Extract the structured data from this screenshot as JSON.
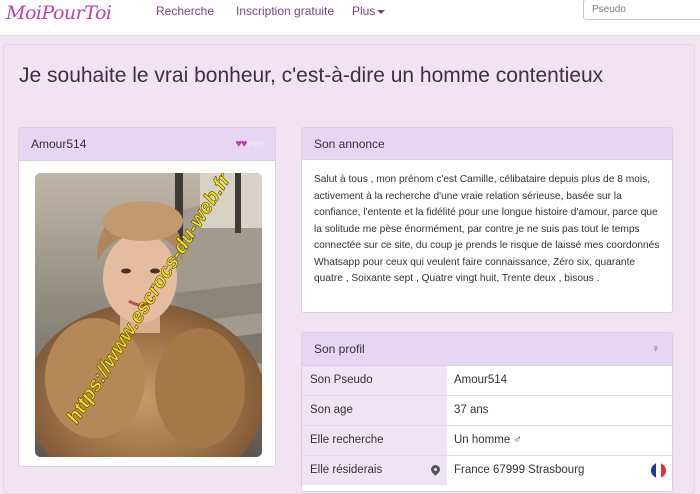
{
  "brand": {
    "logo_text": "MoiPourToi"
  },
  "nav": {
    "recherche": "Recherche",
    "inscription": "Inscription gratuite",
    "plus": "Plus"
  },
  "search": {
    "placeholder": "Pseudo"
  },
  "page": {
    "title": "Je souhaite le vrai bonheur, c'est-à-dire un homme contentieux"
  },
  "profile_card": {
    "username": "Amour514",
    "hearts_filled": 2,
    "hearts_total": 5,
    "photo_watermark": "https://www.escrocs-du-web.fr"
  },
  "annonce": {
    "heading": "Son annonce",
    "text": "Salut à tous , mon prénom c'est Camille, célibataire depuis plus de 8 mois, activement à la recherche d'une vraie relation sérieuse, basée sur la confiance, l'entente et la fidélité pour une longue histoire d'amour, parce que la solitude me pèse énormément, par contre je ne suis pas tout le temps connectée sur ce site, du coup je prends le risque de laissé mes coordonnés Whatsapp pour ceux qui veulent faire connaissance, Zéro six, quarante quatre , Soixante sept , Quatre vingt huit, Trente deux , bisous ."
  },
  "profil": {
    "heading": "Son profil",
    "rows": [
      {
        "label": "Son Pseudo",
        "value": "Amour514"
      },
      {
        "label": "Son age",
        "value": "37 ans"
      },
      {
        "label": "Elle recherche",
        "value": "Un homme ♂"
      },
      {
        "label": "Elle résiderais",
        "value": "France 67999 Strasbourg"
      }
    ]
  },
  "colors": {
    "brand": "#c03fb0",
    "nav_link": "#7e3f8e",
    "panel_heading": "#e6d6f3",
    "background": "#f3e6f3"
  }
}
